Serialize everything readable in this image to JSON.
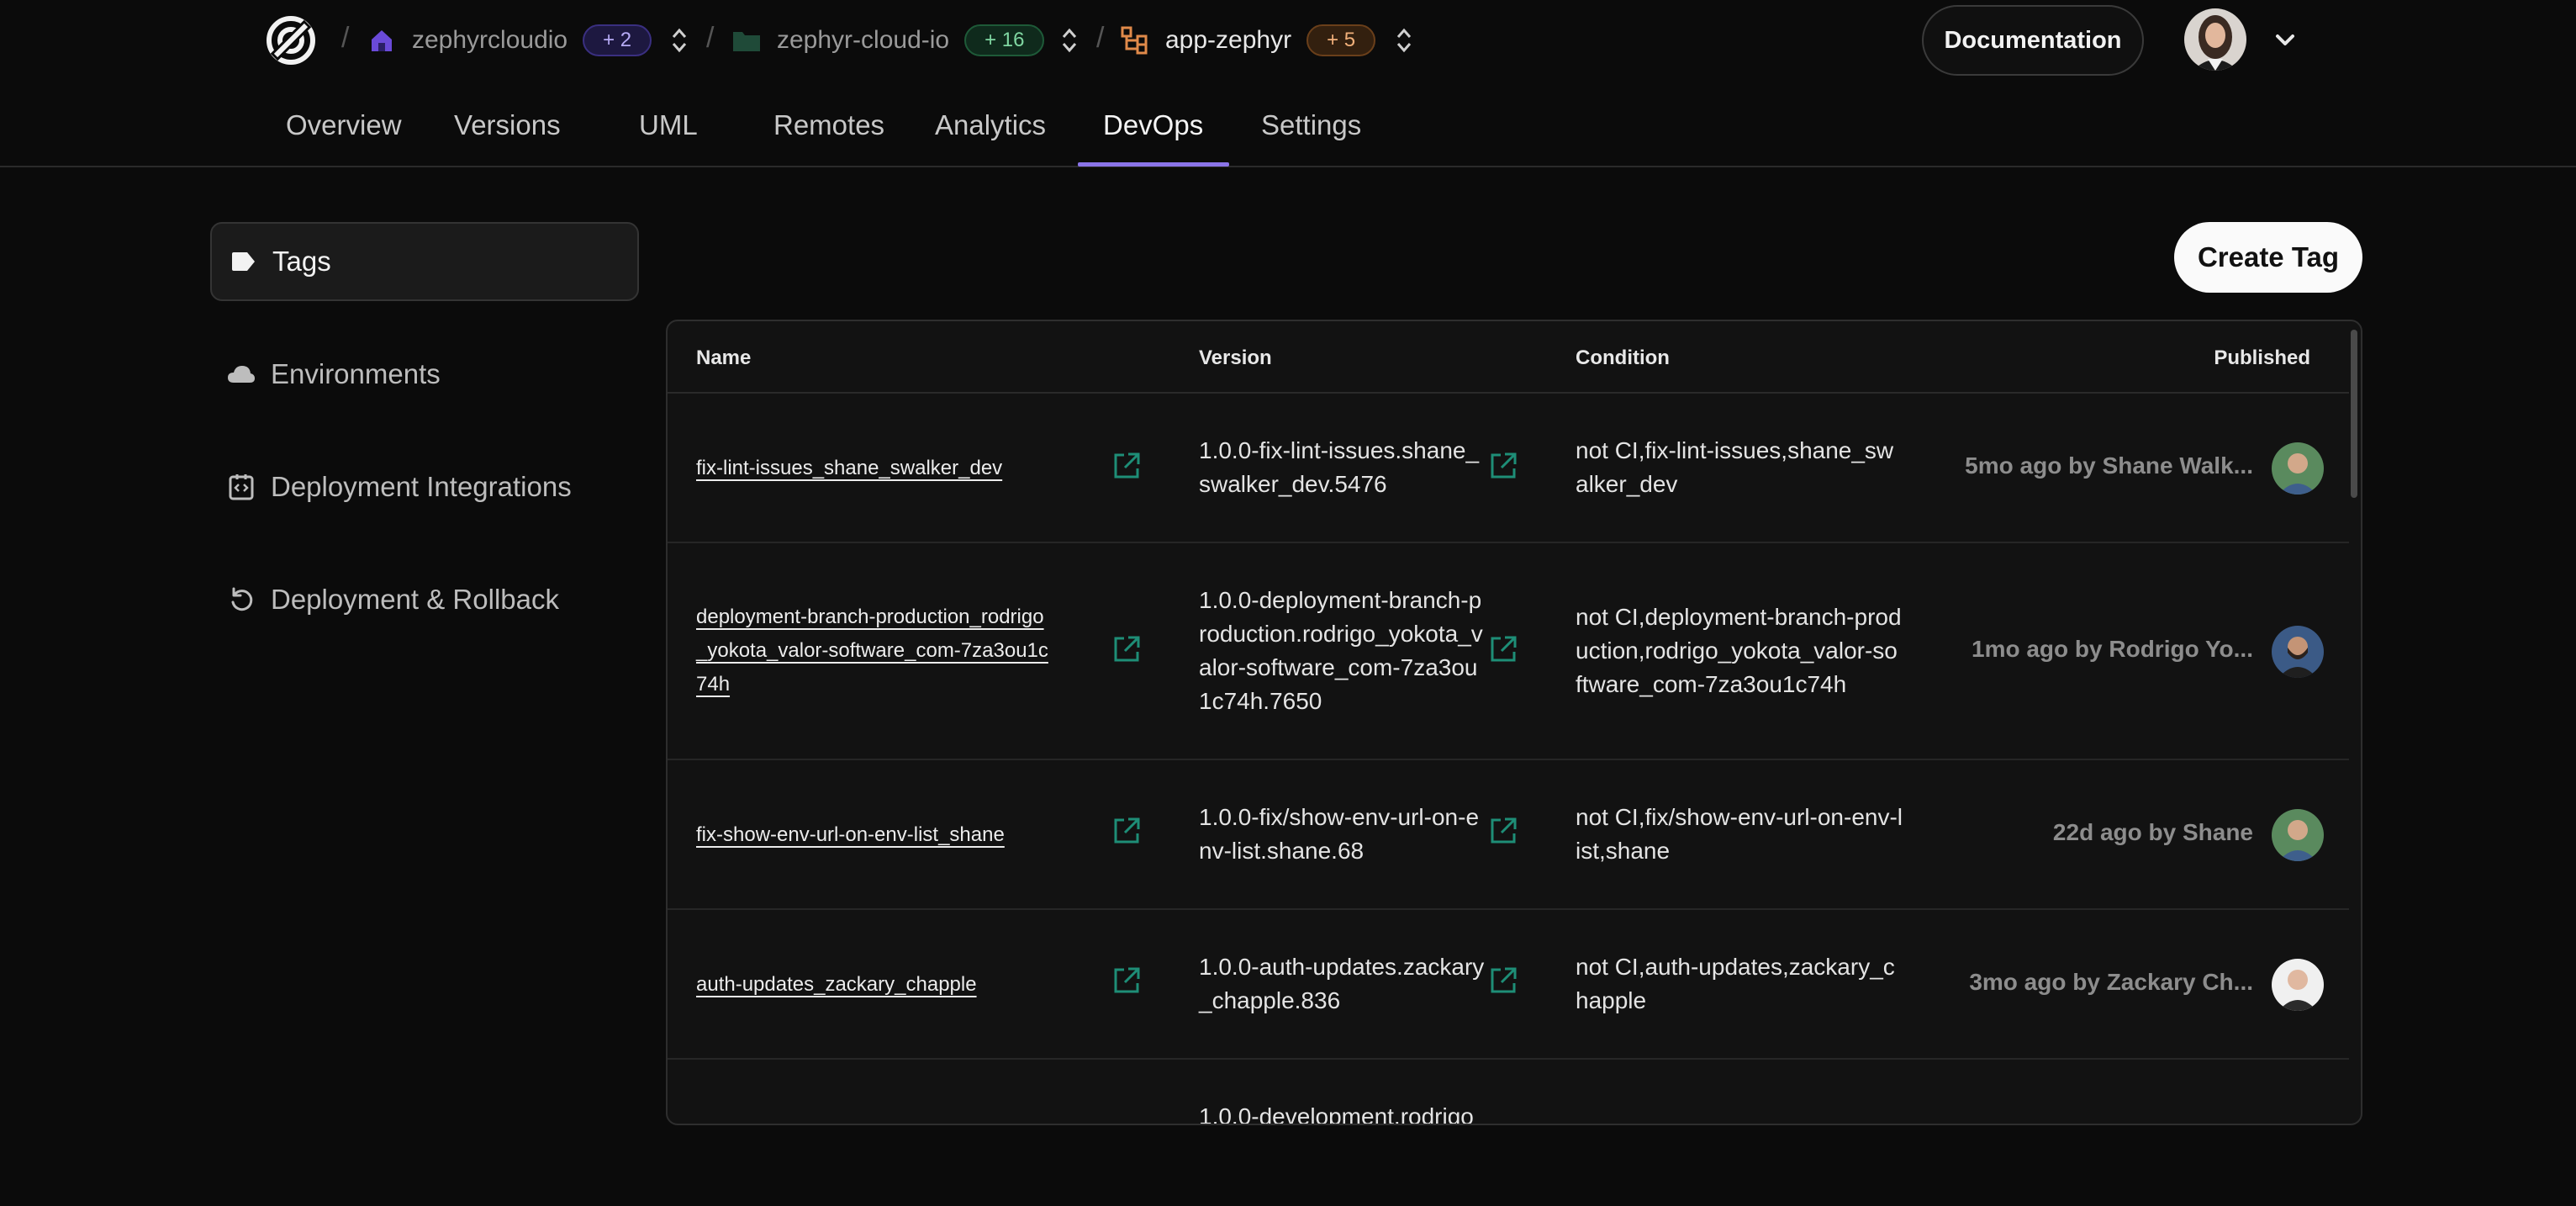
{
  "header": {
    "breadcrumbs": [
      {
        "name": "zephyrcloudio",
        "badge": "+ 2",
        "icon": "home-icon"
      },
      {
        "name": "zephyr-cloud-io",
        "badge": "+ 16",
        "icon": "folder-icon"
      },
      {
        "name": "app-zephyr",
        "badge": "+ 5",
        "icon": "app-tree-icon"
      }
    ],
    "documentation_label": "Documentation"
  },
  "tabs": [
    {
      "label": "Overview"
    },
    {
      "label": "Versions"
    },
    {
      "label": "UML"
    },
    {
      "label": "Remotes"
    },
    {
      "label": "Analytics"
    },
    {
      "label": "DevOps"
    },
    {
      "label": "Settings"
    }
  ],
  "active_tab": "DevOps",
  "sidebar": {
    "items": [
      {
        "label": "Tags",
        "icon": "tag-icon"
      },
      {
        "label": "Environments",
        "icon": "cloud-icon"
      },
      {
        "label": "Deployment Integrations",
        "icon": "integration-icon"
      },
      {
        "label": "Deployment & Rollback",
        "icon": "rollback-icon"
      }
    ]
  },
  "main": {
    "create_label": "Create Tag",
    "columns": {
      "name": "Name",
      "version": "Version",
      "condition": "Condition",
      "published": "Published"
    },
    "rows": [
      {
        "name": "fix-lint-issues_shane_swalker_dev",
        "version": "1.0.0-fix-lint-issues.shane_swalker_dev.5476",
        "condition": "not CI,fix-lint-issues,shane_swalker_dev",
        "published": "5mo ago by Shane Walk..."
      },
      {
        "name": "deployment-branch-production_rodrigo_yokota_valor-software_com-7za3ou1c74h",
        "version": "1.0.0-deployment-branch-production.rodrigo_yokota_valor-software_com-7za3ou1c74h.7650",
        "condition": "not CI,deployment-branch-production,rodrigo_yokota_valor-software_com-7za3ou1c74h",
        "published": "1mo ago by Rodrigo Yo..."
      },
      {
        "name": "fix-show-env-url-on-env-list_shane",
        "version": "1.0.0-fix/show-env-url-on-env-list.shane.68",
        "condition": "not CI,fix/show-env-url-on-env-list,shane",
        "published": "22d ago by Shane"
      },
      {
        "name": "auth-updates_zackary_chapple",
        "version": "1.0.0-auth-updates.zackary_chapple.836",
        "condition": "not CI,auth-updates,zackary_chapple",
        "published": "3mo ago by Zackary Ch..."
      },
      {
        "name": "",
        "version": "1.0.0-development.rodrigo",
        "condition": "",
        "published": ""
      }
    ]
  },
  "colors": {
    "accent": "#8a74e8",
    "background": "#0b0b0b",
    "panel": "#121212"
  }
}
